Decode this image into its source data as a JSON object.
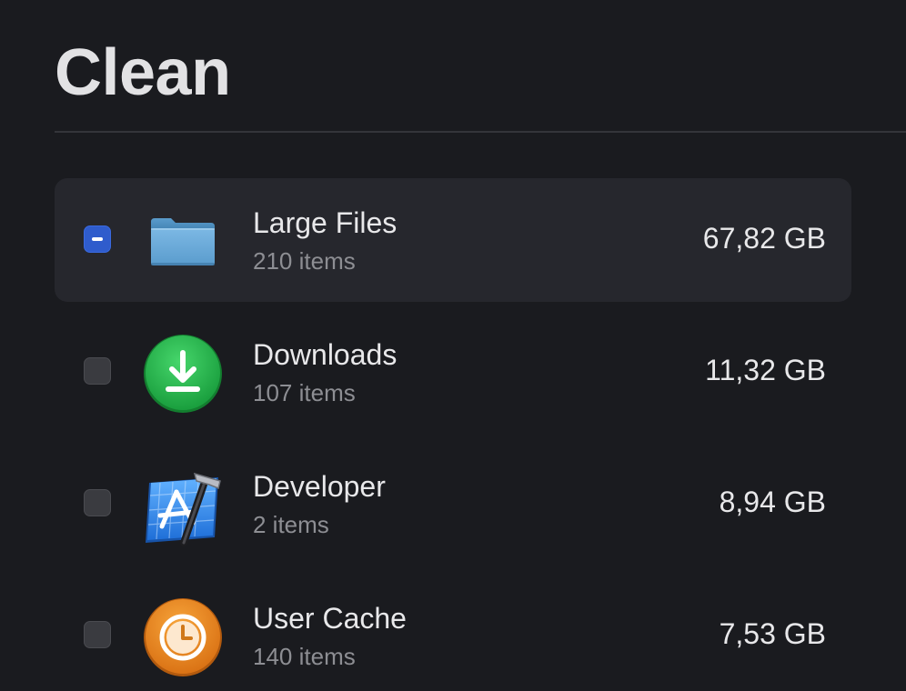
{
  "header": {
    "title": "Clean"
  },
  "items": [
    {
      "name": "Large Files",
      "count": "210 items",
      "size": "67,82 GB",
      "icon": "folder-icon",
      "checked": "mixed",
      "selected": true
    },
    {
      "name": "Downloads",
      "count": "107 items",
      "size": "11,32 GB",
      "icon": "download-icon",
      "checked": "unchecked",
      "selected": false
    },
    {
      "name": "Developer",
      "count": "2 items",
      "size": "8,94 GB",
      "icon": "xcode-icon",
      "checked": "unchecked",
      "selected": false
    },
    {
      "name": "User Cache",
      "count": "140 items",
      "size": "7,53 GB",
      "icon": "clock-icon",
      "checked": "unchecked",
      "selected": false
    }
  ],
  "colors": {
    "background": "#1a1b1f",
    "selected_row": "#26272d",
    "checkbox_accent": "#2f5ccc",
    "downloads_green": "#22b14c",
    "cache_orange": "#e8871e",
    "folder_blue": "#6aa8d6"
  }
}
